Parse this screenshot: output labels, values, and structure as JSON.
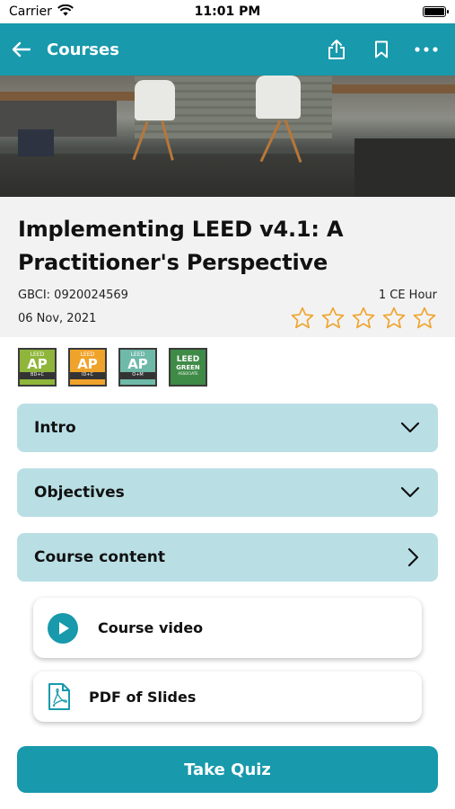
{
  "status_bar": {
    "carrier": "Carrier",
    "time": "11:01 PM"
  },
  "nav": {
    "title": "Courses",
    "icons": [
      "back-arrow-icon",
      "share-icon",
      "bookmark-icon",
      "more-icon"
    ]
  },
  "course": {
    "title": "Implementing LEED v4.1: A Practitioner's Perspective",
    "gbci": "GBCI: 0920024569",
    "ce_hours": "1 CE Hour",
    "date": "06 Nov, 2021",
    "rating": 0,
    "rating_max": 5
  },
  "badges": [
    {
      "top": "LEED",
      "main": "AP",
      "bottom": "BD+C",
      "color": "#8fb63a"
    },
    {
      "top": "LEED",
      "main": "AP",
      "bottom": "ID+C",
      "color": "#f0a32a"
    },
    {
      "top": "LEED",
      "main": "AP",
      "bottom": "O+M",
      "color": "#6fb9a9"
    },
    {
      "top": "LEED",
      "main": "GREEN",
      "bottom": "ASSOCIATE",
      "color": "#3e8a47"
    }
  ],
  "sections": [
    {
      "label": "Intro",
      "icon": "chevron-down-icon"
    },
    {
      "label": "Objectives",
      "icon": "chevron-down-icon"
    },
    {
      "label": "Course content",
      "icon": "chevron-right-icon"
    }
  ],
  "content_items": [
    {
      "label": "Course video",
      "icon": "play-icon"
    },
    {
      "label": "PDF of Slides",
      "icon": "pdf-icon"
    }
  ],
  "quiz_button": "Take Quiz",
  "colors": {
    "accent": "#1899ac",
    "section_bg": "#b9dfe5",
    "star": "#f0a32a"
  }
}
